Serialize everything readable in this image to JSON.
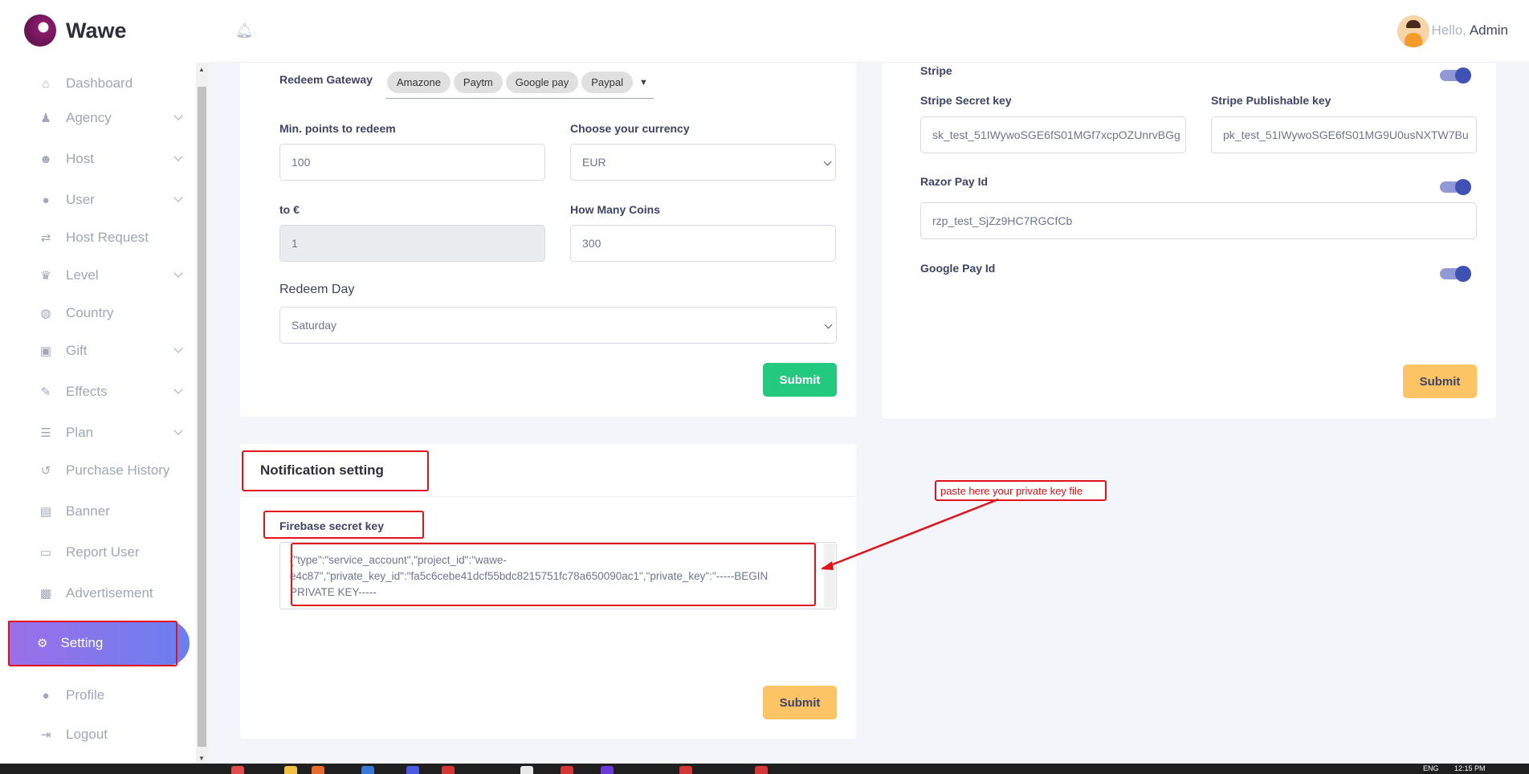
{
  "app": {
    "name": "Wawe"
  },
  "header": {
    "greeting": "Hello,",
    "user": "Admin"
  },
  "sidebar": {
    "items": [
      {
        "label": "Dashboard",
        "icon": "home-icon"
      },
      {
        "label": "Agency",
        "icon": "agency-icon"
      },
      {
        "label": "Host",
        "icon": "host-icon"
      },
      {
        "label": "User",
        "icon": "user-icon"
      },
      {
        "label": "Host Request",
        "icon": "repeat-icon"
      },
      {
        "label": "Level",
        "icon": "trophy-icon"
      },
      {
        "label": "Country",
        "icon": "globe-icon"
      },
      {
        "label": "Gift",
        "icon": "gift-icon"
      },
      {
        "label": "Effects",
        "icon": "wand-icon"
      },
      {
        "label": "Plan",
        "icon": "list-icon"
      },
      {
        "label": "Purchase History",
        "icon": "history-icon"
      },
      {
        "label": "Banner",
        "icon": "image-icon"
      },
      {
        "label": "Report User",
        "icon": "id-card-icon"
      },
      {
        "label": "Advertisement",
        "icon": "ad-icon"
      },
      {
        "label": "Setting",
        "icon": "gear-icon",
        "active": true
      },
      {
        "label": "Profile",
        "icon": "user-icon"
      },
      {
        "label": "Logout",
        "icon": "logout-icon"
      }
    ]
  },
  "redeem": {
    "gateway_label": "Redeem Gateway",
    "gateways": [
      "Amazone",
      "Paytm",
      "Google pay",
      "Paypal"
    ],
    "min_points_label": "Min. points to redeem",
    "min_points_value": "100",
    "currency_label": "Choose your currency",
    "currency_value": "EUR",
    "to_label": "to €",
    "to_value": "1",
    "coins_label": "How Many Coins",
    "coins_value": "300",
    "day_label": "Redeem Day",
    "day_value": "Saturday",
    "submit": "Submit"
  },
  "payment": {
    "stripe_label": "Stripe",
    "stripe_secret_label": "Stripe Secret key",
    "stripe_secret_value": "sk_test_51IWywoSGE6fS01MGf7xcpOZUnrvBGg",
    "stripe_pub_label": "Stripe Publishable key",
    "stripe_pub_value": "pk_test_51IWywoSGE6fS01MG9U0usNXTW7Bu",
    "razor_label": "Razor Pay Id",
    "razor_value": "rzp_test_SjZz9HC7RGCfCb",
    "gpay_label": "Google Pay Id",
    "submit": "Submit"
  },
  "notification": {
    "title": "Notification setting",
    "firebase_label": "Firebase secret key",
    "firebase_line1": "{\"type\":\"service_account\",\"project_id\":\"wawe-",
    "firebase_line2": "e4c87\",\"private_key_id\":\"fa5c6cebe41dcf55bdc8215751fc78a650090ac1\",\"private_key\":\"-----BEGIN",
    "firebase_line3": "PRIVATE KEY-----",
    "submit": "Submit"
  },
  "annotation": {
    "text": "paste  here your private key file"
  },
  "taskbar": {
    "lang": "ENG",
    "time": "12:15 PM"
  }
}
